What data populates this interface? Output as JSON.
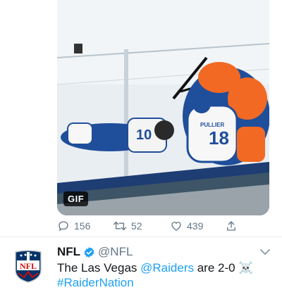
{
  "media": {
    "badge": "GIF",
    "jersey_number_left": "10",
    "jersey_number_right": "18",
    "jersey_name": "PULLIER"
  },
  "actions": {
    "replies": "156",
    "retweets": "52",
    "likes": "439"
  },
  "tweet": {
    "name": "NFL",
    "handle": "@NFL",
    "text_prefix": "The Las Vegas ",
    "mention": "@Raiders",
    "text_suffix": " are 2-0 ☠️",
    "hashtag": "#RaiderNation",
    "avatar_label": "NFL"
  },
  "colors": {
    "accent": "#1da1f2",
    "muted": "#657786",
    "islanders_blue": "#1f4e9a",
    "islanders_orange": "#f26924"
  }
}
